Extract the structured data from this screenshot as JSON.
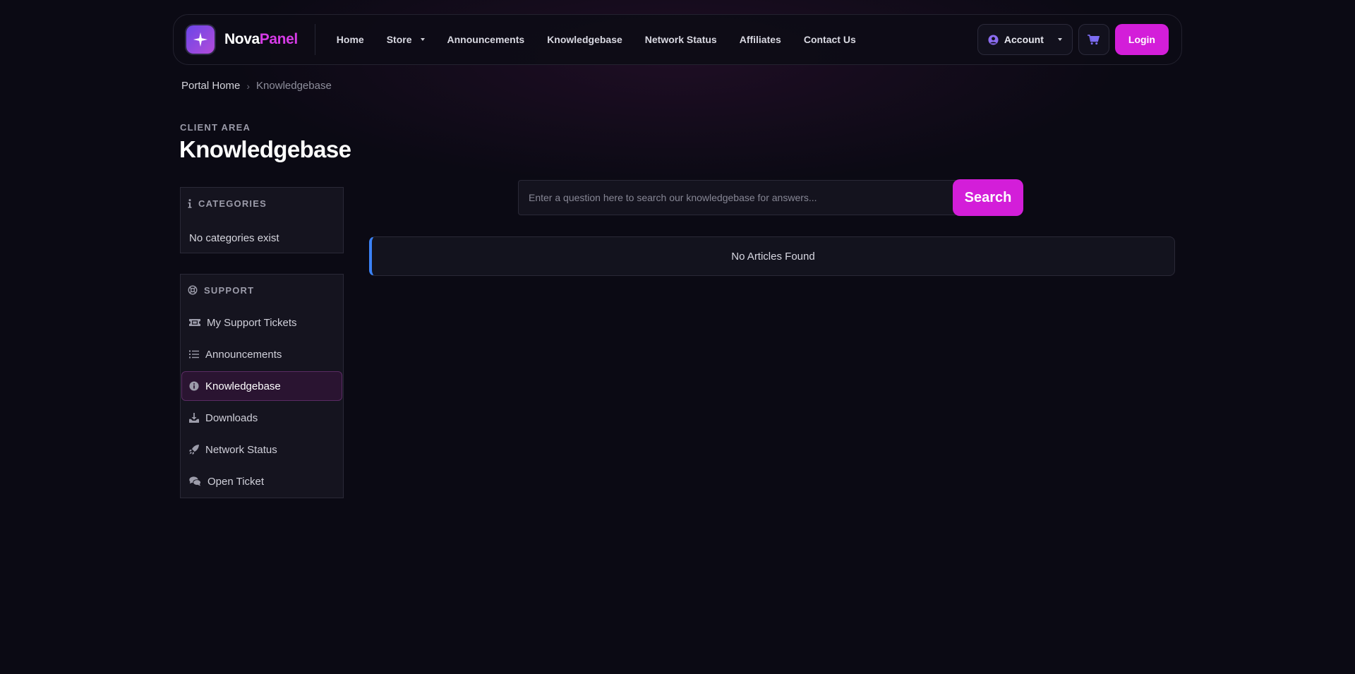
{
  "brand": {
    "name_first": "Nova",
    "name_second": "Panel"
  },
  "nav": {
    "home": "Home",
    "store": "Store",
    "announcements": "Announcements",
    "knowledgebase": "Knowledgebase",
    "network_status": "Network Status",
    "affiliates": "Affiliates",
    "contact_us": "Contact Us",
    "account": "Account",
    "login": "Login"
  },
  "breadcrumb": {
    "home": "Portal Home",
    "current": "Knowledgebase"
  },
  "header": {
    "eyebrow": "CLIENT AREA",
    "title": "Knowledgebase"
  },
  "categories": {
    "title": "CATEGORIES",
    "empty": "No categories exist"
  },
  "support": {
    "title": "SUPPORT",
    "items": [
      {
        "label": "My Support Tickets",
        "icon": "ticket-icon"
      },
      {
        "label": "Announcements",
        "icon": "list-icon"
      },
      {
        "label": "Knowledgebase",
        "icon": "info-icon"
      },
      {
        "label": "Downloads",
        "icon": "download-icon"
      },
      {
        "label": "Network Status",
        "icon": "rocket-icon"
      },
      {
        "label": "Open Ticket",
        "icon": "comments-icon"
      }
    ]
  },
  "search": {
    "placeholder": "Enter a question here to search our knowledgebase for answers...",
    "button": "Search"
  },
  "results": {
    "empty": "No Articles Found"
  },
  "colors": {
    "accent": "#d31ed9",
    "info_border": "#3b82f6",
    "background": "#0b0a14"
  }
}
